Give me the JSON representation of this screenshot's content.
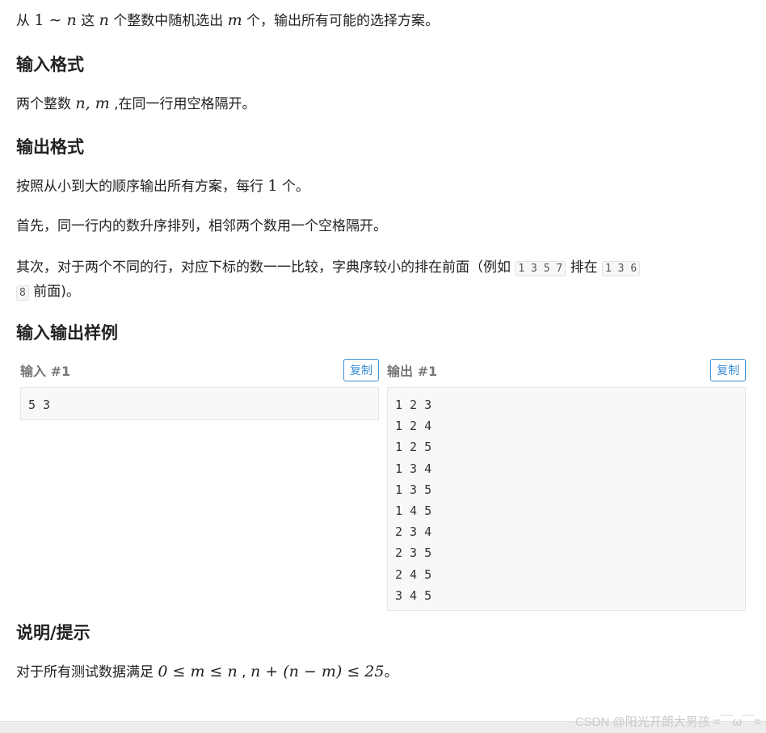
{
  "description": {
    "p1": [
      "从 ",
      "1",
      " ∼ ",
      "n",
      " 这 ",
      "n",
      " 个整数中随机选出 ",
      "m",
      " 个，输出所有可能的选择方案。"
    ]
  },
  "input_format": {
    "title": "输入格式",
    "text": [
      "两个整数 ",
      "n, m",
      " ,在同一行用空格隔开。"
    ]
  },
  "output_format": {
    "title": "输出格式",
    "p1": [
      "按照从小到大的顺序输出所有方案，每行 ",
      "1",
      " 个。"
    ],
    "p2": "首先，同一行内的数升序排列，相邻两个数用一个空格隔开。",
    "p3_a": "其次，对于两个不同的行，对应下标的数一一比较，字典序较小的排在前面（例如 ",
    "code1": "1 3 5 7",
    "p3_b": " 排在 ",
    "code2a": "1 3 6",
    "code2b": "8",
    "p3_c": " 前面)。"
  },
  "samples": {
    "title": "输入输出样例",
    "input_label": "输入 #1",
    "output_label": "输出 #1",
    "copy_label": "复制",
    "input_lines": [
      "5 3"
    ],
    "output_lines": [
      "1 2 3",
      "1 2 4",
      "1 2 5",
      "1 3 4",
      "1 3 5",
      "1 4 5",
      "2 3 4",
      "2 3 5",
      "2 4 5",
      "3 4 5"
    ]
  },
  "hint": {
    "title": "说明/提示",
    "text_a": "对于所有测试数据满足 ",
    "math1": "0 ≤ m ≤ n",
    "sep": " , ",
    "math2": "n + (n − m) ≤ 25",
    "text_b": "。"
  },
  "watermark": "CSDN @阳光开朗大男孩 =￣ω￣="
}
